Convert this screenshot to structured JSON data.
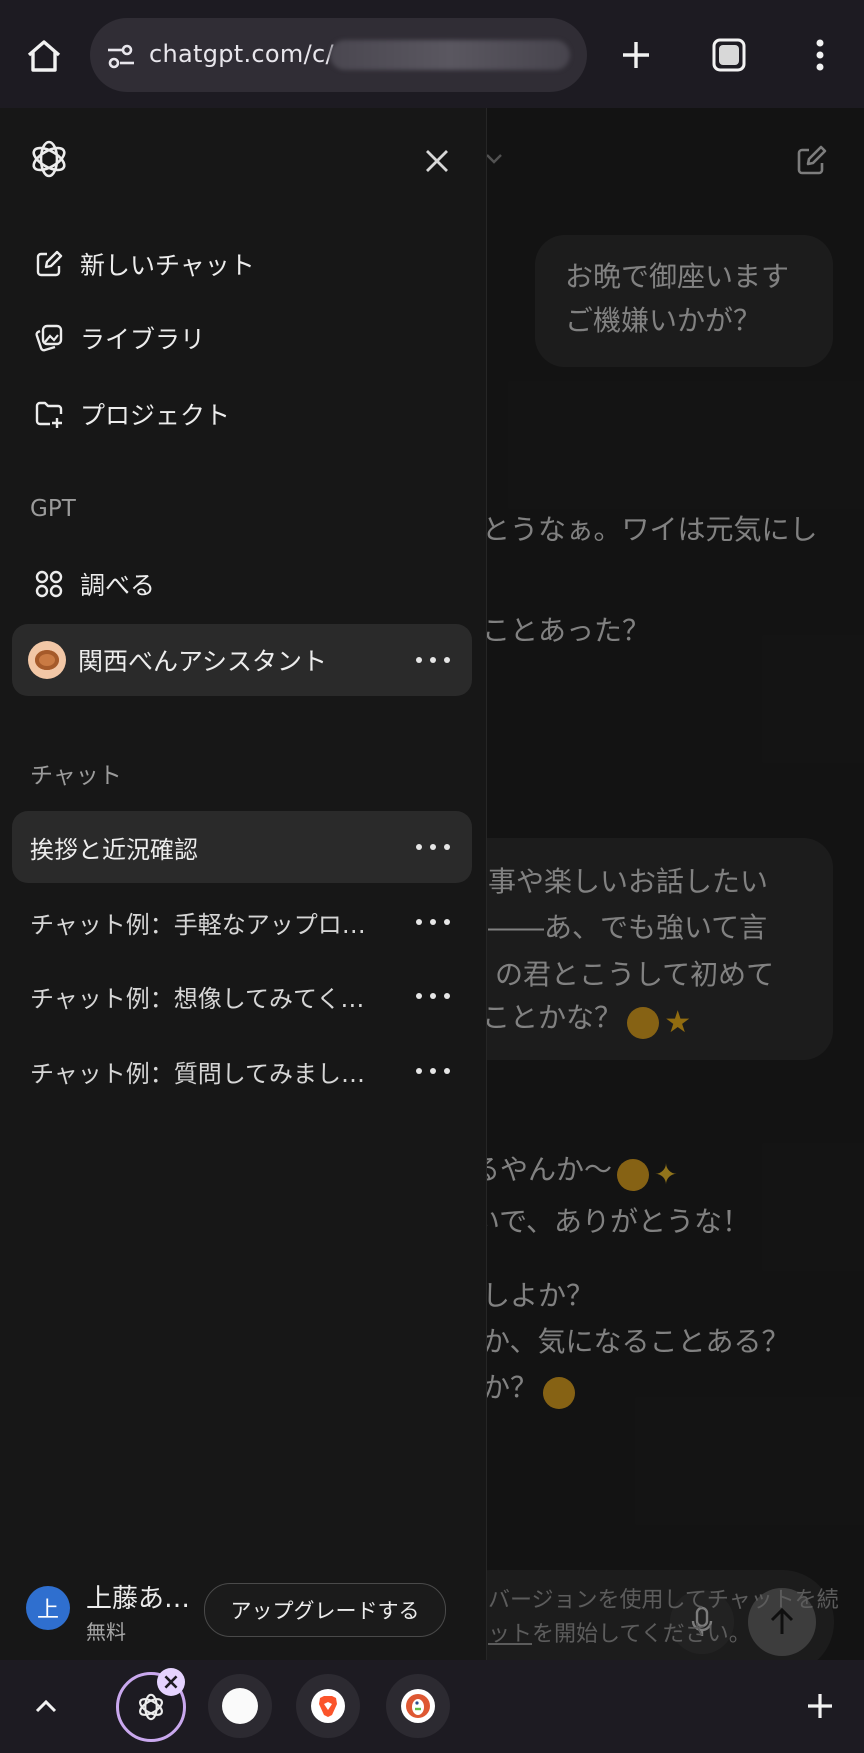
{
  "browser": {
    "url_visible": "chatgpt.com/c/",
    "home_icon": "home-icon",
    "tune_icon": "tune-icon",
    "new_tab_icon": "plus-icon",
    "tabs_icon": "tab-switcher-icon",
    "menu_icon": "more-vert-icon"
  },
  "sidebar": {
    "logo_icon": "openai-logo-icon",
    "close_icon": "close-icon",
    "nav": [
      {
        "label": "新しいチャット",
        "icon": "edit-icon"
      },
      {
        "label": "ライブラリ",
        "icon": "library-icon"
      },
      {
        "label": "プロジェクト",
        "icon": "folder-plus-icon"
      }
    ],
    "gpt_section": "GPT",
    "gpt_items": [
      {
        "label": "調べる",
        "icon": "grid-icon"
      },
      {
        "label": "関西べんアシスタント",
        "icon": "takoyaki-avatar"
      }
    ],
    "chat_section": "チャット",
    "chats": [
      {
        "label": "挨拶と近況確認",
        "selected": true
      },
      {
        "label": "チャット例：手軽なアップロ…",
        "selected": false
      },
      {
        "label": "チャット例：想像してみてく…",
        "selected": false
      },
      {
        "label": "チャット例：質問してみまし…",
        "selected": false
      }
    ],
    "user": {
      "avatar_letter": "上",
      "name": "上藤あ…",
      "plan": "無料",
      "upgrade_label": "アップグレードする"
    }
  },
  "chat": {
    "user_bubble_line1": "お晩で御座います",
    "user_bubble_line2": "ご機嫌いかが？",
    "reply1_line1": "とうなぁ。ワイは元気にし",
    "reply1_line2": "ことあった？",
    "bubble2_line1": "事や楽しいお話したい",
    "bubble2_line2": "――あ、でも強いて言",
    "bubble2_line3": "の君とこうして初めて",
    "bubble2_line4": "ことかな？",
    "reply2_line1": "るやんか〜",
    "reply2_line2": "いで、ありがとうな！",
    "reply2_line3": "しよか？",
    "reply2_line4": "か、気になることある？",
    "reply2_line5": "か？",
    "footer_line1": "バージョンを使用してチャットを続",
    "footer_line2": "ットを開始してください。",
    "footer_link": "ット",
    "footer_line2_rest": "を開始してください。"
  },
  "tab_strip": {
    "expand_icon": "chevron-up-icon",
    "tabs": [
      "chatgpt-tab",
      "blank-tab",
      "brave-tab",
      "duckduckgo-tab"
    ],
    "add_icon": "plus-icon"
  }
}
